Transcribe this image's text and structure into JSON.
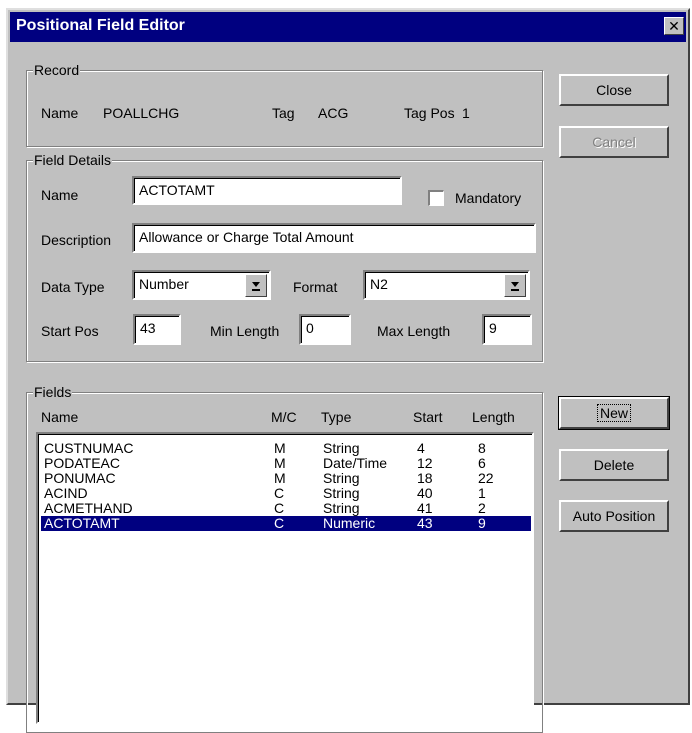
{
  "window": {
    "title": "Positional Field Editor"
  },
  "record": {
    "legend": "Record",
    "name_label": "Name",
    "name_value": "POALLCHG",
    "tag_label": "Tag",
    "tag_value": "ACG",
    "tagpos_label": "Tag Pos",
    "tagpos_value": "1"
  },
  "field_details": {
    "legend": "Field Details",
    "name_label": "Name",
    "name_value": "ACTOTAMT",
    "mandatory_label": "Mandatory",
    "mandatory_checked": false,
    "description_label": "Description",
    "description_value": "Allowance or Charge Total Amount",
    "datatype_label": "Data Type",
    "datatype_value": "Number",
    "format_label": "Format",
    "format_value": "N2",
    "startpos_label": "Start Pos",
    "startpos_value": "43",
    "minlength_label": "Min Length",
    "minlength_value": "0",
    "maxlength_label": "Max Length",
    "maxlength_value": "9"
  },
  "fields": {
    "legend": "Fields",
    "columns": [
      "Name",
      "M/C",
      "Type",
      "Start",
      "Length"
    ],
    "rows": [
      {
        "name": "CUSTNUMAC",
        "mc": "M",
        "type": "String",
        "start": "4",
        "length": "8"
      },
      {
        "name": "PODATEAC",
        "mc": "M",
        "type": "Date/Time",
        "start": "12",
        "length": "6"
      },
      {
        "name": "PONUMAC",
        "mc": "M",
        "type": "String",
        "start": "18",
        "length": "22"
      },
      {
        "name": "ACIND",
        "mc": "C",
        "type": "String",
        "start": "40",
        "length": "1"
      },
      {
        "name": "ACMETHAND",
        "mc": "C",
        "type": "String",
        "start": "41",
        "length": "2"
      },
      {
        "name": "ACTOTAMT",
        "mc": "C",
        "type": "Numeric",
        "start": "43",
        "length": "9"
      }
    ],
    "selected_index": 5
  },
  "buttons": {
    "close": "Close",
    "cancel": "Cancel",
    "new": "New",
    "delete": "Delete",
    "auto_position": "Auto Position"
  },
  "icons": {
    "title_close": "close-icon",
    "dropdown": "dropdown-arrow-icon"
  },
  "colors": {
    "selection": "#000080",
    "titlebar": "#000080",
    "face": "#c0c0c0"
  }
}
